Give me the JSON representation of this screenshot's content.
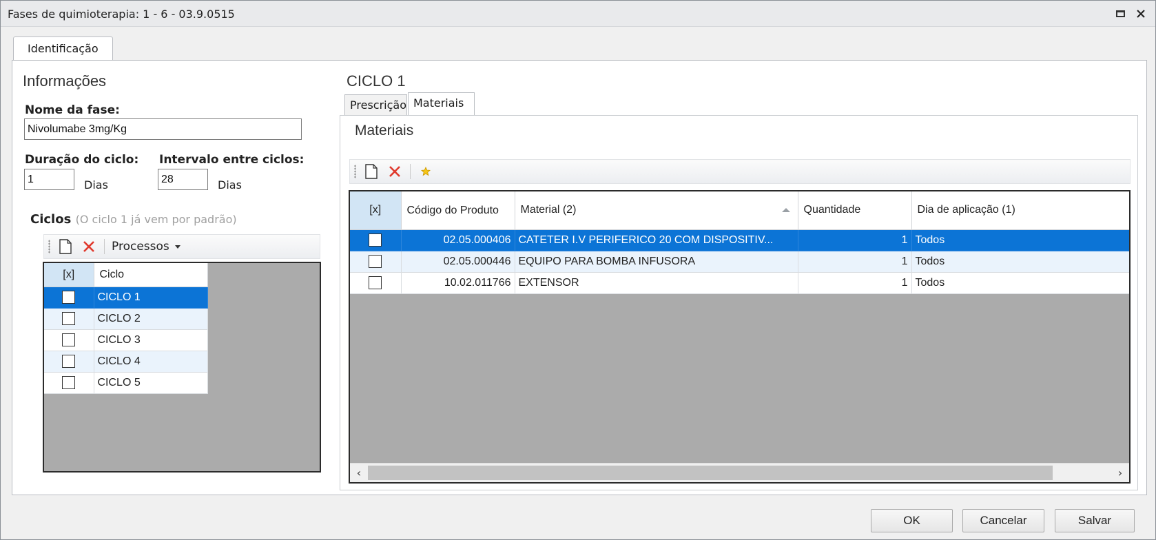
{
  "window": {
    "title": "Fases de quimioterapia: 1 - 6 - 03.9.0515"
  },
  "tabs": {
    "identificacao": "Identificação"
  },
  "left": {
    "section_title": "Informações",
    "nome_label": "Nome da fase:",
    "nome_value": "Nivolumabe 3mg/Kg",
    "duracao_label": "Duração do ciclo:",
    "duracao_value": "1",
    "duracao_unit": "Dias",
    "intervalo_label": "Intervalo entre ciclos:",
    "intervalo_value": "28",
    "intervalo_unit": "Dias",
    "ciclos_label": "Ciclos",
    "ciclos_hint": "(O ciclo 1 já vem por padrão)",
    "toolbar": {
      "processos_label": "Processos"
    },
    "grid": {
      "col_select": "[x]",
      "col_ciclo": "Ciclo",
      "rows": [
        {
          "label": "CICLO 1",
          "selected": true
        },
        {
          "label": "CICLO 2"
        },
        {
          "label": "CICLO 3"
        },
        {
          "label": "CICLO 4"
        },
        {
          "label": "CICLO 5"
        }
      ]
    }
  },
  "right": {
    "ciclo_title": "CICLO 1",
    "tabs": {
      "prescricao": "Prescrição",
      "materiais": "Materiais"
    },
    "materiais_title": "Materiais",
    "grid": {
      "col_select": "[x]",
      "col_codigo": "Código do Produto",
      "col_material": "Material (2)",
      "col_quantidade": "Quantidade",
      "col_dia": "Dia de aplicação (1)",
      "rows": [
        {
          "codigo": "02.05.000406",
          "material": "CATETER I.V PERIFERICO 20 COM DISPOSITIV...",
          "quantidade": "1",
          "dia": "Todos",
          "selected": true
        },
        {
          "codigo": "02.05.000446",
          "material": "EQUIPO PARA BOMBA INFUSORA",
          "quantidade": "1",
          "dia": "Todos"
        },
        {
          "codigo": "10.02.011766",
          "material": "EXTENSOR",
          "quantidade": "1",
          "dia": "Todos"
        }
      ]
    }
  },
  "footer": {
    "ok": "OK",
    "cancelar": "Cancelar",
    "salvar": "Salvar"
  },
  "colors": {
    "selection": "#0c74d6",
    "alt_row": "#eaf3fc",
    "grid_bg": "#ababab",
    "delete_red": "#e03a2e"
  }
}
